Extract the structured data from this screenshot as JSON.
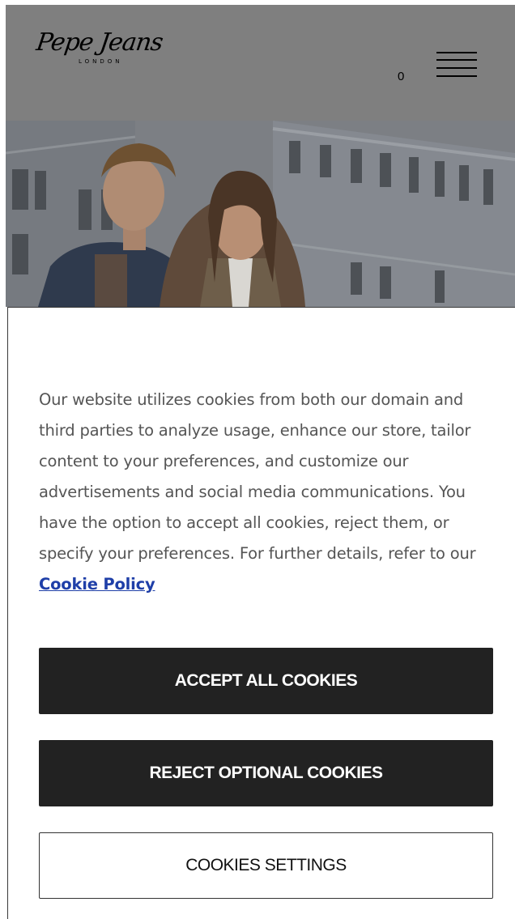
{
  "header": {
    "logo_text": "Pepe Jeans",
    "logo_subtext": "LONDON",
    "cart_count": "0"
  },
  "cookie_banner": {
    "message": "Our website utilizes cookies from both our domain and third parties to analyze usage, enhance our store, tailor content to your preferences, and customize our advertisements and social media communications. You have the option to accept all cookies, reject them, or specify your preferences. For further details, refer to our",
    "policy_link": "Cookie Policy",
    "accept_label": "ACCEPT ALL COOKIES",
    "reject_label": "REJECT OPTIONAL COOKIES",
    "settings_label": "COOKIES SETTINGS"
  },
  "colors": {
    "overlay": "#7f7f7f",
    "button_dark": "#222222",
    "link": "#1f3fa8",
    "text": "#555555"
  },
  "icons": {
    "menu": "hamburger-icon"
  }
}
